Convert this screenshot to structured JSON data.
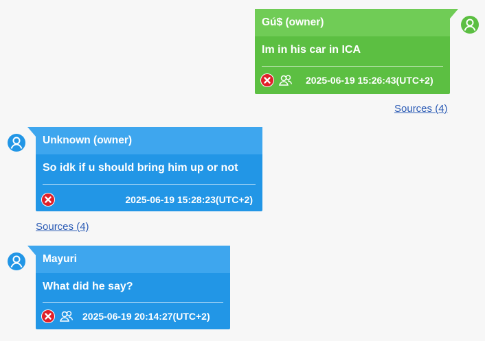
{
  "colors": {
    "outgoing_bubble": "#5cbf42",
    "outgoing_header": "#70cc56",
    "incoming_bubble": "#2296e6",
    "incoming_header": "#3ea6ee",
    "link": "#2b5bb5",
    "delete_icon": "#e0202a"
  },
  "messages": [
    {
      "sender": "Gú$ (owner)",
      "text": "Im in his car in ICA",
      "timestamp": "2025-06-19 15:26:43(UTC+2)",
      "sources": "Sources (4)",
      "icons": [
        "deleted-icon",
        "contacts-icon"
      ],
      "avatar": "user-avatar-icon"
    },
    {
      "sender": "Unknown (owner)",
      "text": "So idk if u should bring him up or not",
      "timestamp": "2025-06-19 15:28:23(UTC+2)",
      "sources": "Sources (4)",
      "icons": [
        "deleted-icon"
      ],
      "avatar": "user-avatar-icon"
    },
    {
      "sender": "Mayuri",
      "text": "What did he say?",
      "timestamp": "2025-06-19 20:14:27(UTC+2)",
      "icons": [
        "deleted-icon",
        "contacts-icon"
      ],
      "avatar": "user-avatar-icon"
    }
  ]
}
